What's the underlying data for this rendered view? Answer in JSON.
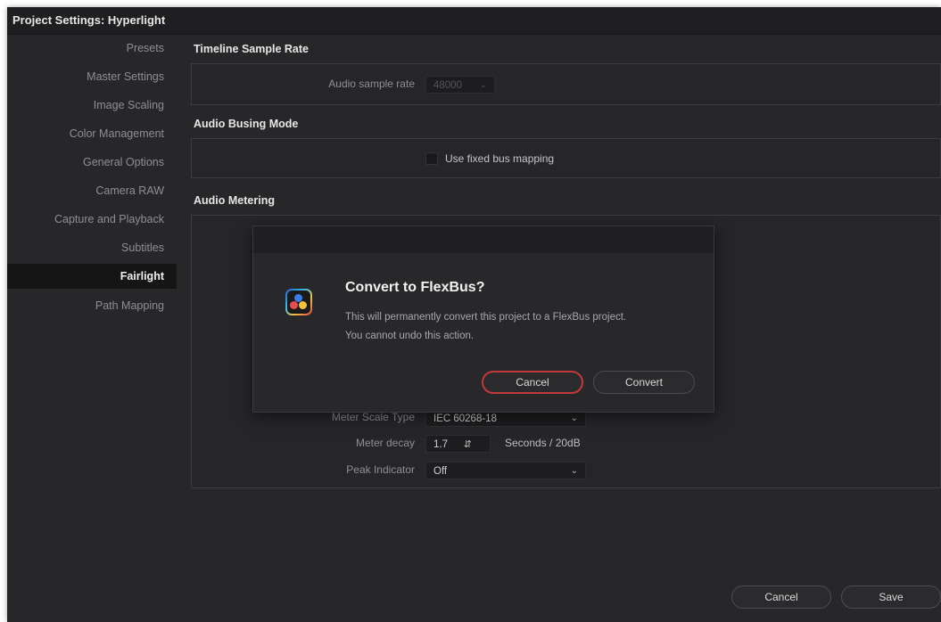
{
  "window": {
    "title": "Project Settings:  Hyperlight"
  },
  "sidebar": {
    "items": [
      {
        "label": "Presets"
      },
      {
        "label": "Master Settings"
      },
      {
        "label": "Image Scaling"
      },
      {
        "label": "Color Management"
      },
      {
        "label": "General Options"
      },
      {
        "label": "Camera RAW"
      },
      {
        "label": "Capture and Playback"
      },
      {
        "label": "Subtitles"
      },
      {
        "label": "Fairlight",
        "active": true
      },
      {
        "label": "Path Mapping"
      }
    ]
  },
  "sections": {
    "sample_rate": {
      "title": "Timeline Sample Rate",
      "audio_sample_rate_label": "Audio sample rate",
      "audio_sample_rate_value": "48000"
    },
    "busing": {
      "title": "Audio Busing Mode",
      "fixed_bus_mapping_label": "Use fixed bus mapping",
      "fixed_bus_mapping_checked": false
    },
    "metering": {
      "title": "Audio Metering",
      "meter_scale_type_label": "Meter Scale Type",
      "meter_scale_type_value": "IEC 60268-18",
      "meter_decay_label": "Meter decay",
      "meter_decay_value": "1.7",
      "meter_decay_unit": "Seconds / 20dB",
      "peak_indicator_label": "Peak Indicator",
      "peak_indicator_value": "Off"
    }
  },
  "footer": {
    "cancel_label": "Cancel",
    "save_label": "Save"
  },
  "dialog": {
    "title": "Convert to FlexBus?",
    "body": "This will permanently convert this project to a FlexBus project. You cannot undo this action.",
    "cancel_label": "Cancel",
    "convert_label": "Convert"
  },
  "colors": {
    "window_bg": "#27272a",
    "titlebar_bg": "#1f1f21",
    "active_item_bg": "#151516",
    "dialog_cancel_border": "#c2393d"
  },
  "icons": {
    "dialog_icon": "davinci-resolve-app-icon",
    "dropdown": "chevron-down-icon",
    "stepper": "up-down-stepper-icon"
  }
}
